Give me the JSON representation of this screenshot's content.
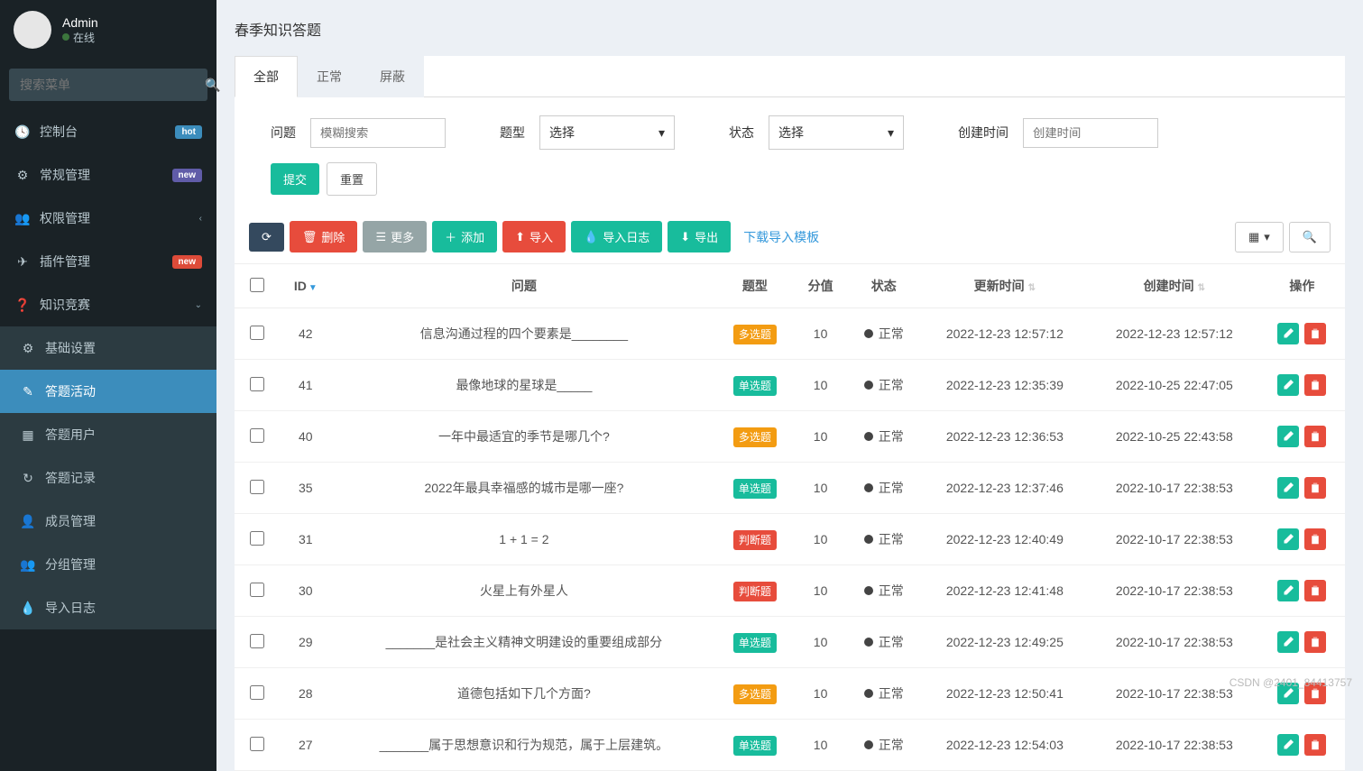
{
  "user": {
    "name": "Admin",
    "status": "在线"
  },
  "search": {
    "placeholder": "搜索菜单"
  },
  "nav": {
    "console": "控制台",
    "general": "常规管理",
    "permission": "权限管理",
    "plugin": "插件管理",
    "quiz": "知识竞赛",
    "basic": "基础设置",
    "activity": "答题活动",
    "users": "答题用户",
    "records": "答题记录",
    "members": "成员管理",
    "groups": "分组管理",
    "import": "导入日志",
    "badges": {
      "hot": "hot",
      "new": "new",
      "new2": "new"
    }
  },
  "page": {
    "title": "春季知识答题"
  },
  "tabs": [
    "全部",
    "正常",
    "屏蔽"
  ],
  "filters": {
    "question_label": "问题",
    "question_placeholder": "模糊搜索",
    "type_label": "题型",
    "type_value": "选择",
    "status_label": "状态",
    "status_value": "选择",
    "time_label": "创建时间",
    "time_placeholder": "创建时间",
    "submit": "提交",
    "reset": "重置"
  },
  "toolbar": {
    "delete": "删除",
    "more": "更多",
    "add": "添加",
    "import": "导入",
    "import_log": "导入日志",
    "export": "导出",
    "download_tpl": "下载导入模板"
  },
  "columns": {
    "id": "ID",
    "question": "问题",
    "type": "题型",
    "score": "分值",
    "status": "状态",
    "update": "更新时间",
    "create": "创建时间",
    "op": "操作"
  },
  "types": {
    "multi": "多选题",
    "single": "单选题",
    "judge": "判断题"
  },
  "status_normal": "正常",
  "rows": [
    {
      "id": "42",
      "q": "信息沟通过程的四个要素是________",
      "type": "multi",
      "score": "10",
      "update": "2022-12-23 12:57:12",
      "create": "2022-12-23 12:57:12"
    },
    {
      "id": "41",
      "q": "最像地球的星球是_____",
      "type": "single",
      "score": "10",
      "update": "2022-12-23 12:35:39",
      "create": "2022-10-25 22:47:05"
    },
    {
      "id": "40",
      "q": "一年中最适宜的季节是哪几个?",
      "type": "multi",
      "score": "10",
      "update": "2022-12-23 12:36:53",
      "create": "2022-10-25 22:43:58"
    },
    {
      "id": "35",
      "q": "2022年最具幸福感的城市是哪一座?",
      "type": "single",
      "score": "10",
      "update": "2022-12-23 12:37:46",
      "create": "2022-10-17 22:38:53"
    },
    {
      "id": "31",
      "q": "1 + 1 = 2",
      "type": "judge",
      "score": "10",
      "update": "2022-12-23 12:40:49",
      "create": "2022-10-17 22:38:53"
    },
    {
      "id": "30",
      "q": "火星上有外星人",
      "type": "judge",
      "score": "10",
      "update": "2022-12-23 12:41:48",
      "create": "2022-10-17 22:38:53"
    },
    {
      "id": "29",
      "q": "_______是社会主义精神文明建设的重要组成部分",
      "type": "single",
      "score": "10",
      "update": "2022-12-23 12:49:25",
      "create": "2022-10-17 22:38:53"
    },
    {
      "id": "28",
      "q": "道德包括如下几个方面?",
      "type": "multi",
      "score": "10",
      "update": "2022-12-23 12:50:41",
      "create": "2022-10-17 22:38:53"
    },
    {
      "id": "27",
      "q": "_______属于思想意识和行为规范，属于上层建筑。",
      "type": "single",
      "score": "10",
      "update": "2022-12-23 12:54:03",
      "create": "2022-10-17 22:38:53"
    }
  ],
  "watermark": "CSDN @2401_84413757"
}
